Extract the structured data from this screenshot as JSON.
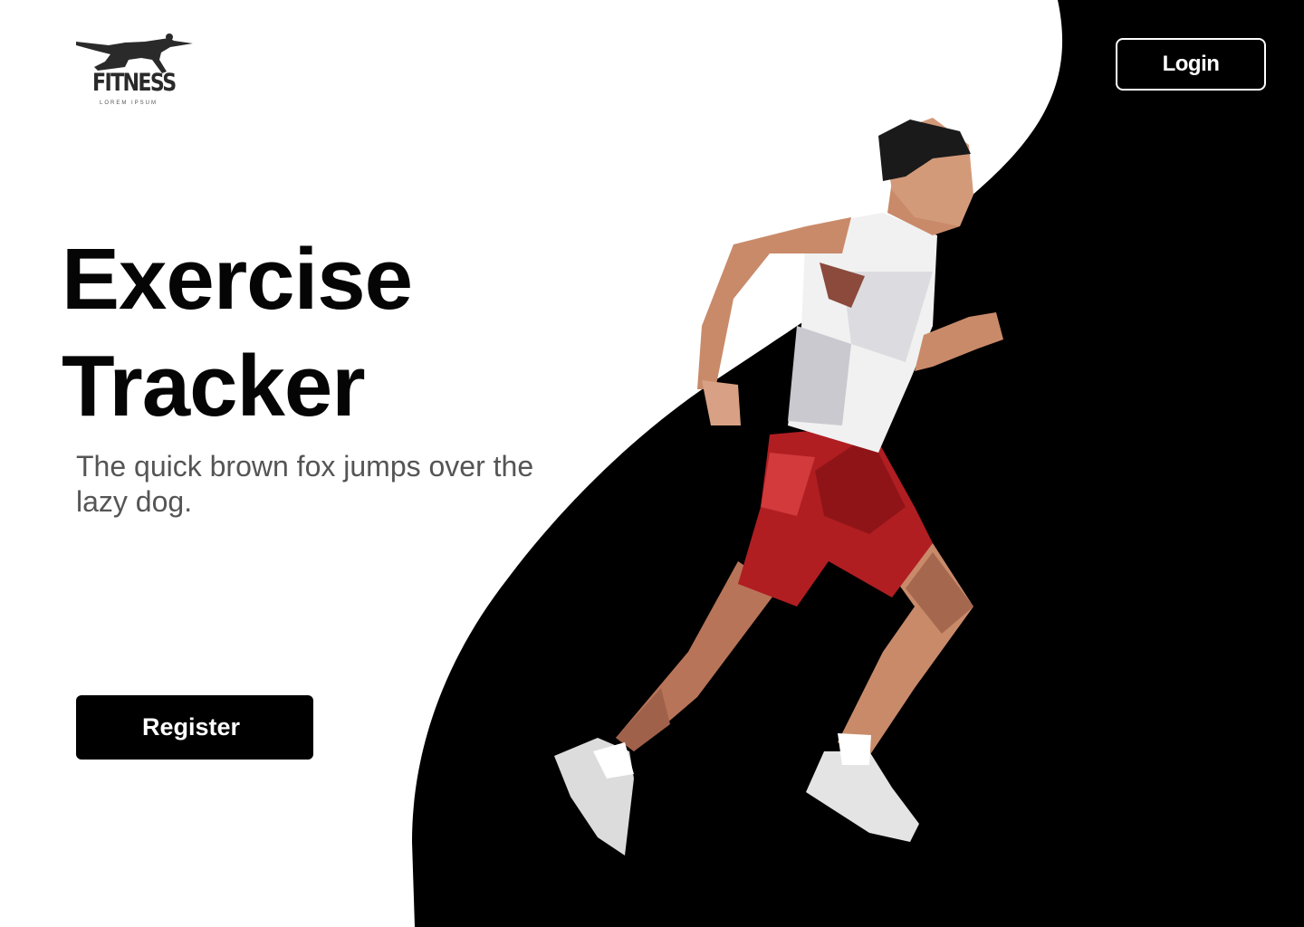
{
  "brand": {
    "name": "FITNESS",
    "tagline": "LOREM IPSUM"
  },
  "header": {
    "login_label": "Login"
  },
  "hero": {
    "title_line1": "Exercise",
    "title_line2": "Tracker",
    "subtitle": "The quick brown fox jumps over the lazy dog.",
    "register_label": "Register"
  },
  "colors": {
    "background": "#ffffff",
    "accent": "#000000",
    "shorts": "#b01e22",
    "skin": "#c98a6a"
  },
  "icons": [
    "fitness-logo-icon",
    "runner-illustration"
  ]
}
